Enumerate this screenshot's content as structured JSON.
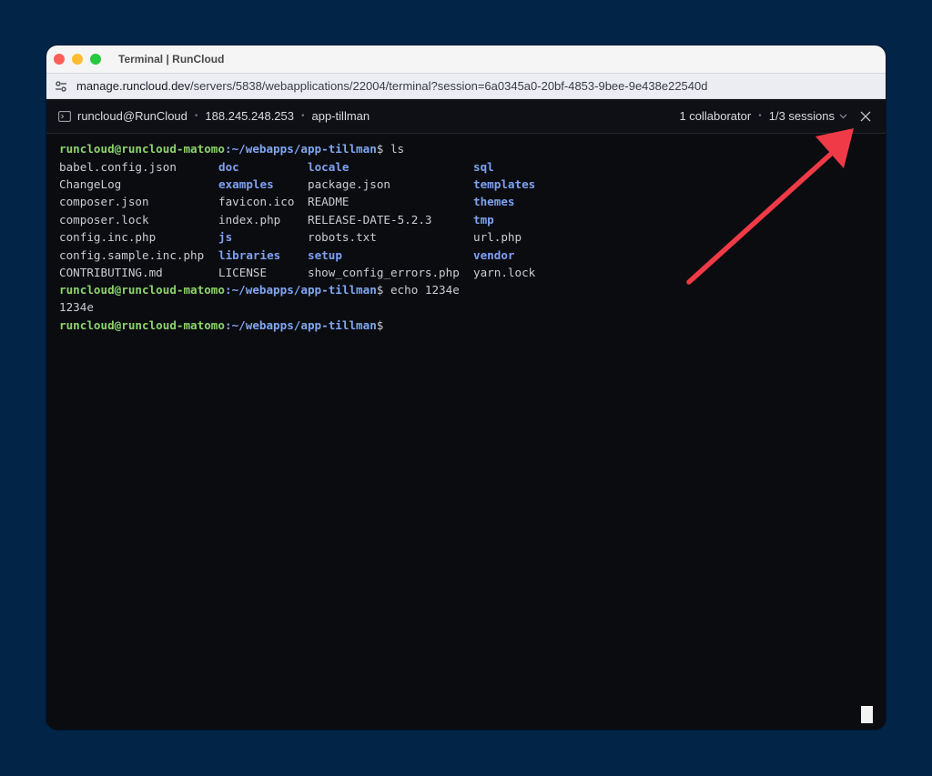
{
  "window": {
    "title": "Terminal | RunCloud"
  },
  "urlbar": {
    "host": "manage.runcloud.dev",
    "path": "/servers/5838/webapplications/22004/terminal?session=6a0345a0-20bf-4853-9bee-9e438e22540d"
  },
  "term_header": {
    "user_host": "runcloud@RunCloud",
    "ip": "188.245.248.253",
    "app": "app-tillman",
    "collaborators": "1 collaborator",
    "sessions": "1/3 sessions",
    "separator": "•"
  },
  "terminal": {
    "prompt_user": "runcloud@runcloud-matomo",
    "prompt_path": ":~/webapps/app-tillman",
    "cmd1": "$ ls",
    "ls_rows": [
      [
        {
          "t": "babel.config.json",
          "dir": false
        },
        {
          "t": "doc",
          "dir": true
        },
        {
          "t": "locale",
          "dir": true
        },
        {
          "t": "sql",
          "dir": true
        }
      ],
      [
        {
          "t": "ChangeLog",
          "dir": false
        },
        {
          "t": "examples",
          "dir": true
        },
        {
          "t": "package.json",
          "dir": false
        },
        {
          "t": "templates",
          "dir": true
        }
      ],
      [
        {
          "t": "composer.json",
          "dir": false
        },
        {
          "t": "favicon.ico",
          "dir": false
        },
        {
          "t": "README",
          "dir": false
        },
        {
          "t": "themes",
          "dir": true
        }
      ],
      [
        {
          "t": "composer.lock",
          "dir": false
        },
        {
          "t": "index.php",
          "dir": false
        },
        {
          "t": "RELEASE-DATE-5.2.3",
          "dir": false
        },
        {
          "t": "tmp",
          "dir": true
        }
      ],
      [
        {
          "t": "config.inc.php",
          "dir": false
        },
        {
          "t": "js",
          "dir": true
        },
        {
          "t": "robots.txt",
          "dir": false
        },
        {
          "t": "url.php",
          "dir": false
        }
      ],
      [
        {
          "t": "config.sample.inc.php",
          "dir": false
        },
        {
          "t": "libraries",
          "dir": true
        },
        {
          "t": "setup",
          "dir": true
        },
        {
          "t": "vendor",
          "dir": true
        }
      ],
      [
        {
          "t": "CONTRIBUTING.md",
          "dir": false
        },
        {
          "t": "LICENSE",
          "dir": false
        },
        {
          "t": "show_config_errors.php",
          "dir": false
        },
        {
          "t": "yarn.lock",
          "dir": false
        }
      ]
    ],
    "cmd2": "$ echo 1234e",
    "output2": "1234e",
    "cmd3": "$"
  },
  "colors": {
    "background": "#012447",
    "prompt": "#8cd46a",
    "path": "#7fa6f0",
    "dir": "#7ea1f2",
    "arrow": "#f03a47"
  },
  "icons": [
    "settings-sliders-icon",
    "terminal-icon",
    "chevron-down-icon",
    "close-icon"
  ]
}
